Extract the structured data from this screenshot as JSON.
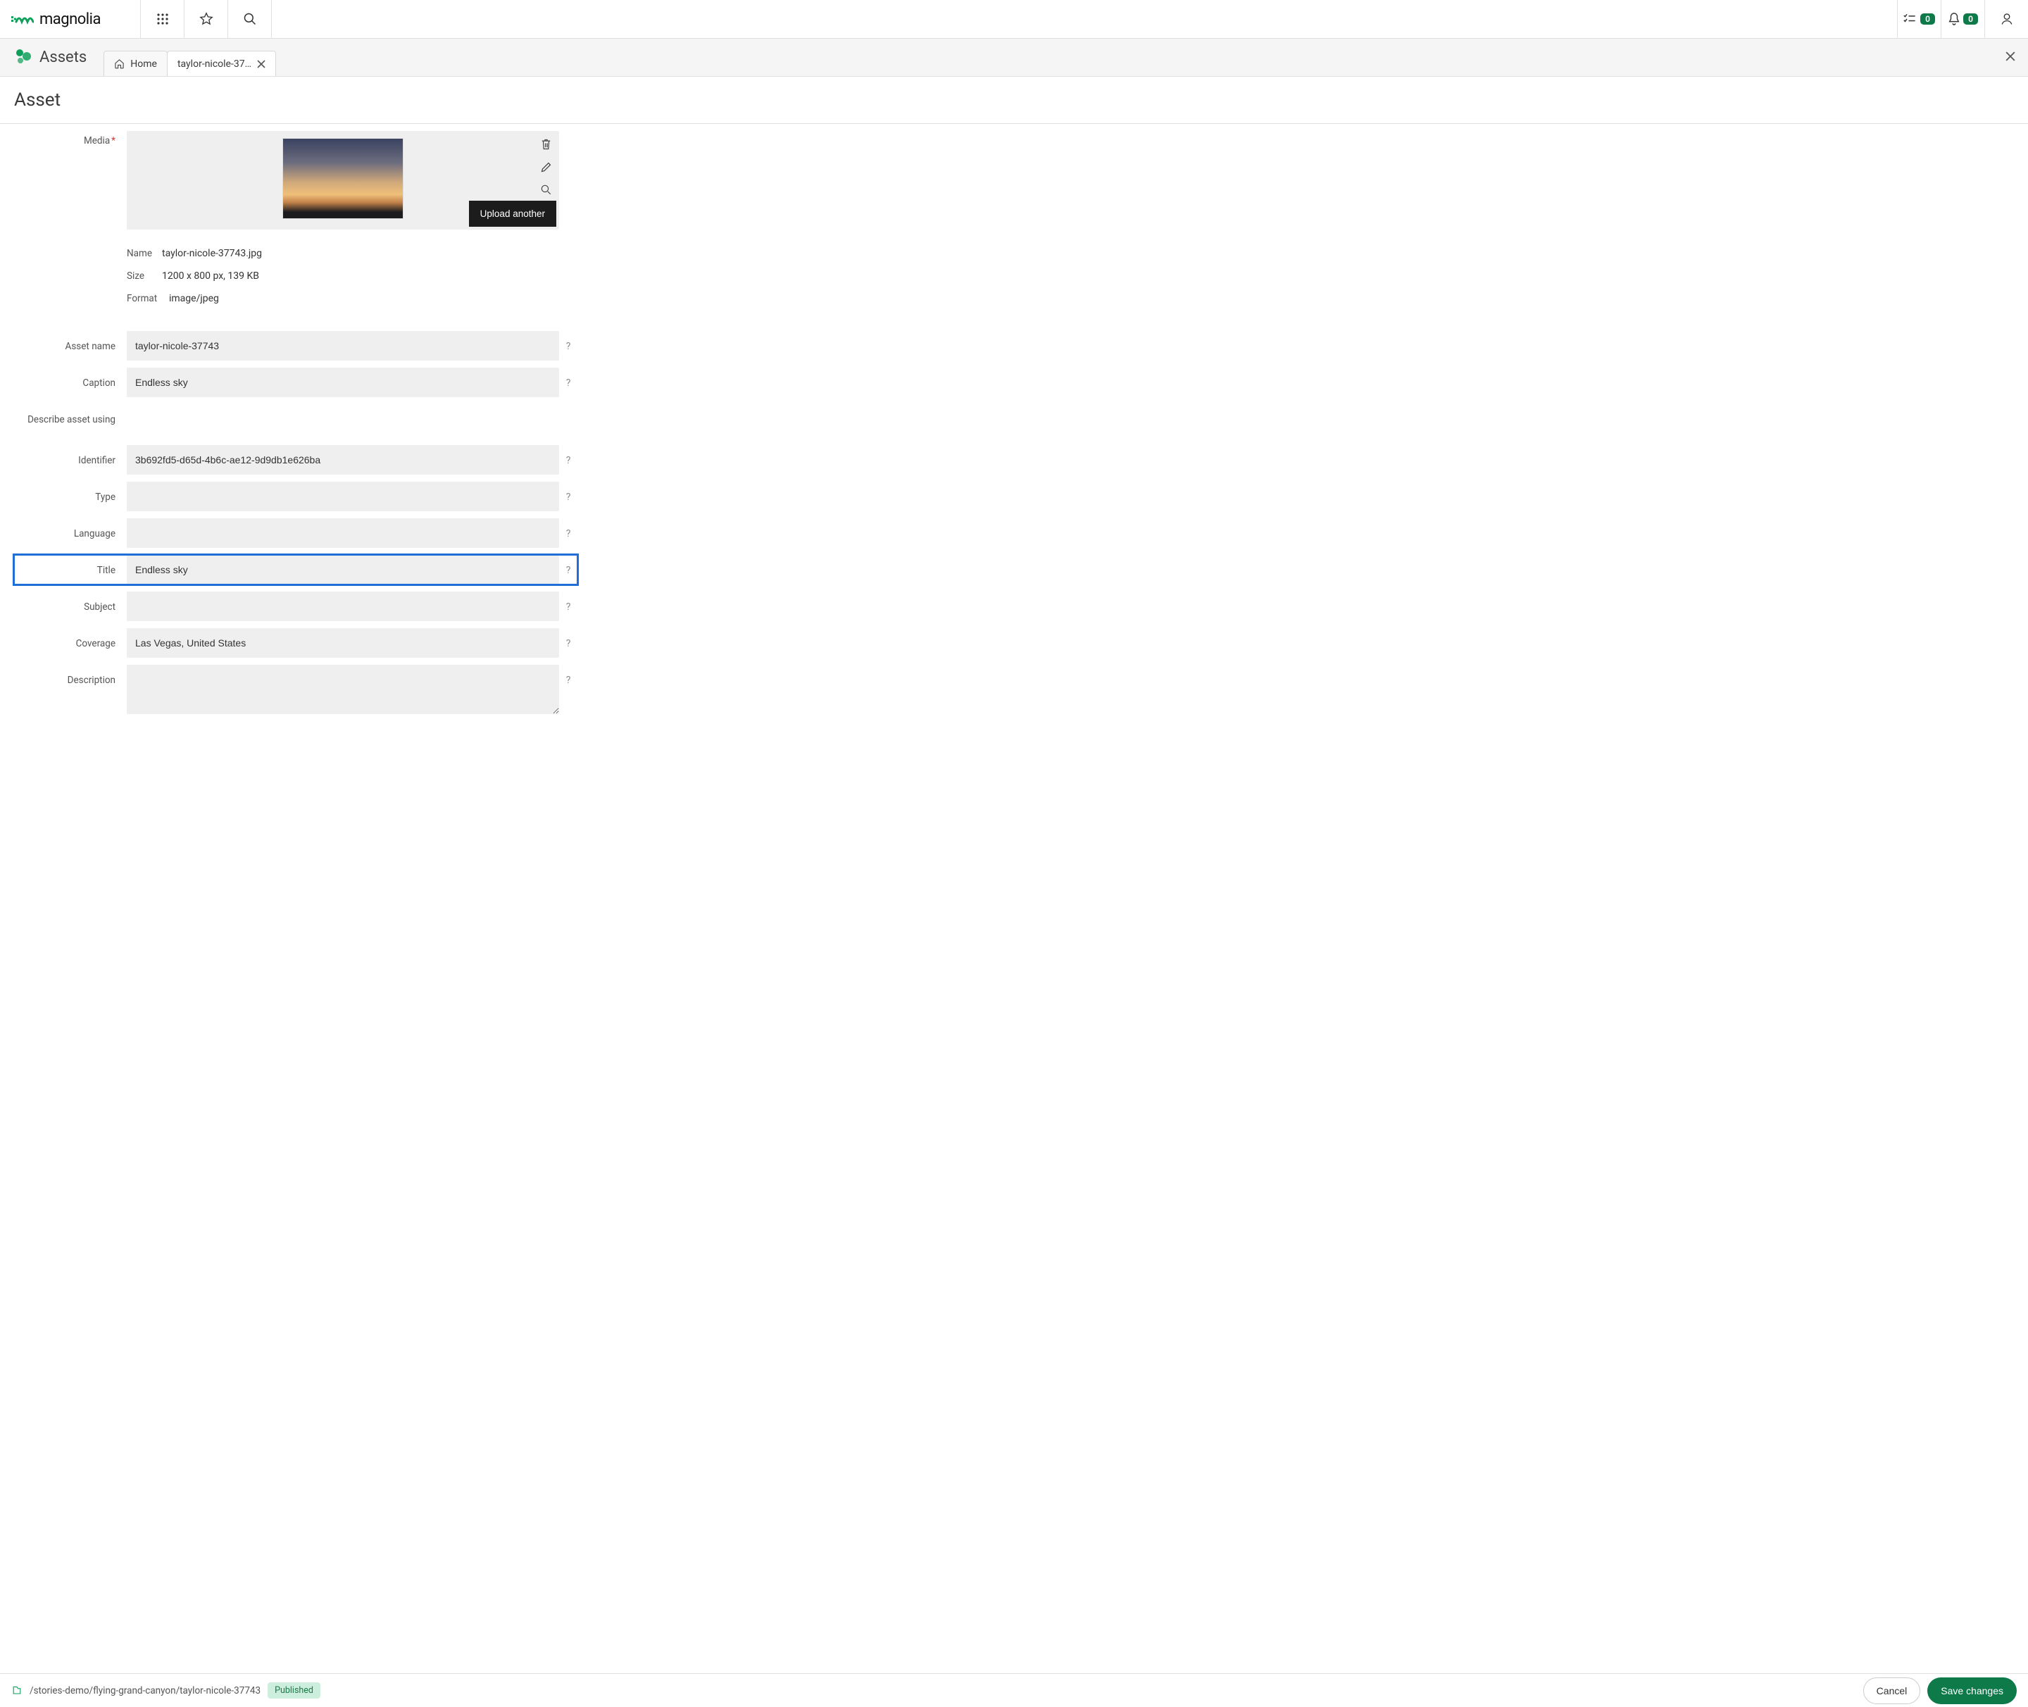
{
  "brand": "magnolia",
  "topbar": {
    "tasks_badge": "0",
    "notifications_badge": "0"
  },
  "app": {
    "name": "Assets"
  },
  "tabs": {
    "home": "Home",
    "active": "taylor-nicole-37…"
  },
  "page_title": "Asset",
  "media": {
    "label": "Media",
    "upload_another": "Upload another",
    "info": {
      "name_label": "Name",
      "name_value": "taylor-nicole-37743.jpg",
      "size_label": "Size",
      "size_value": "1200 x 800 px, 139 KB",
      "format_label": "Format",
      "format_value": "image/jpeg"
    }
  },
  "fields": {
    "asset_name": {
      "label": "Asset name",
      "value": "taylor-nicole-37743"
    },
    "caption": {
      "label": "Caption",
      "value": "Endless sky"
    },
    "describe": {
      "label": "Describe asset using"
    },
    "identifier": {
      "label": "Identifier",
      "value": "3b692fd5-d65d-4b6c-ae12-9d9db1e626ba"
    },
    "type": {
      "label": "Type",
      "value": ""
    },
    "language": {
      "label": "Language",
      "value": ""
    },
    "title": {
      "label": "Title",
      "value": "Endless sky"
    },
    "subject": {
      "label": "Subject",
      "value": ""
    },
    "coverage": {
      "label": "Coverage",
      "value": "Las Vegas, United States"
    },
    "description": {
      "label": "Description",
      "value": ""
    }
  },
  "footer": {
    "path": "/stories-demo/flying-grand-canyon/taylor-nicole-37743",
    "status": "Published",
    "cancel": "Cancel",
    "save": "Save changes"
  }
}
